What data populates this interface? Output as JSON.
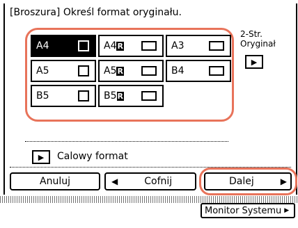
{
  "title": "[Broszura] Określ format oryginału.",
  "paper_sizes": [
    {
      "label": "A4",
      "bold_suffix": "",
      "orientation": "portrait",
      "selected": true
    },
    {
      "label": "A4",
      "bold_suffix": "R",
      "orientation": "landscape",
      "selected": false
    },
    {
      "label": "A3",
      "bold_suffix": "",
      "orientation": "landscape",
      "selected": false
    },
    {
      "label": "A5",
      "bold_suffix": "",
      "orientation": "portrait",
      "selected": false
    },
    {
      "label": "A5",
      "bold_suffix": "R",
      "orientation": "landscape",
      "selected": false
    },
    {
      "label": "B4",
      "bold_suffix": "",
      "orientation": "landscape",
      "selected": false
    },
    {
      "label": "B5",
      "bold_suffix": "",
      "orientation": "portrait",
      "selected": false
    },
    {
      "label": "B5",
      "bold_suffix": "R",
      "orientation": "landscape",
      "selected": false
    }
  ],
  "two_sided": {
    "line1": "2-Str.",
    "line2": "Oryginał",
    "icon": "arrow-right-icon"
  },
  "inch_format": {
    "label": "Calowy format",
    "icon": "arrow-right-icon"
  },
  "nav": {
    "cancel": "Anuluj",
    "back": "Cofnij",
    "next": "Dalej"
  },
  "status": {
    "monitor": "Monitor Systemu"
  },
  "colors": {
    "highlight": "#e8735a"
  }
}
